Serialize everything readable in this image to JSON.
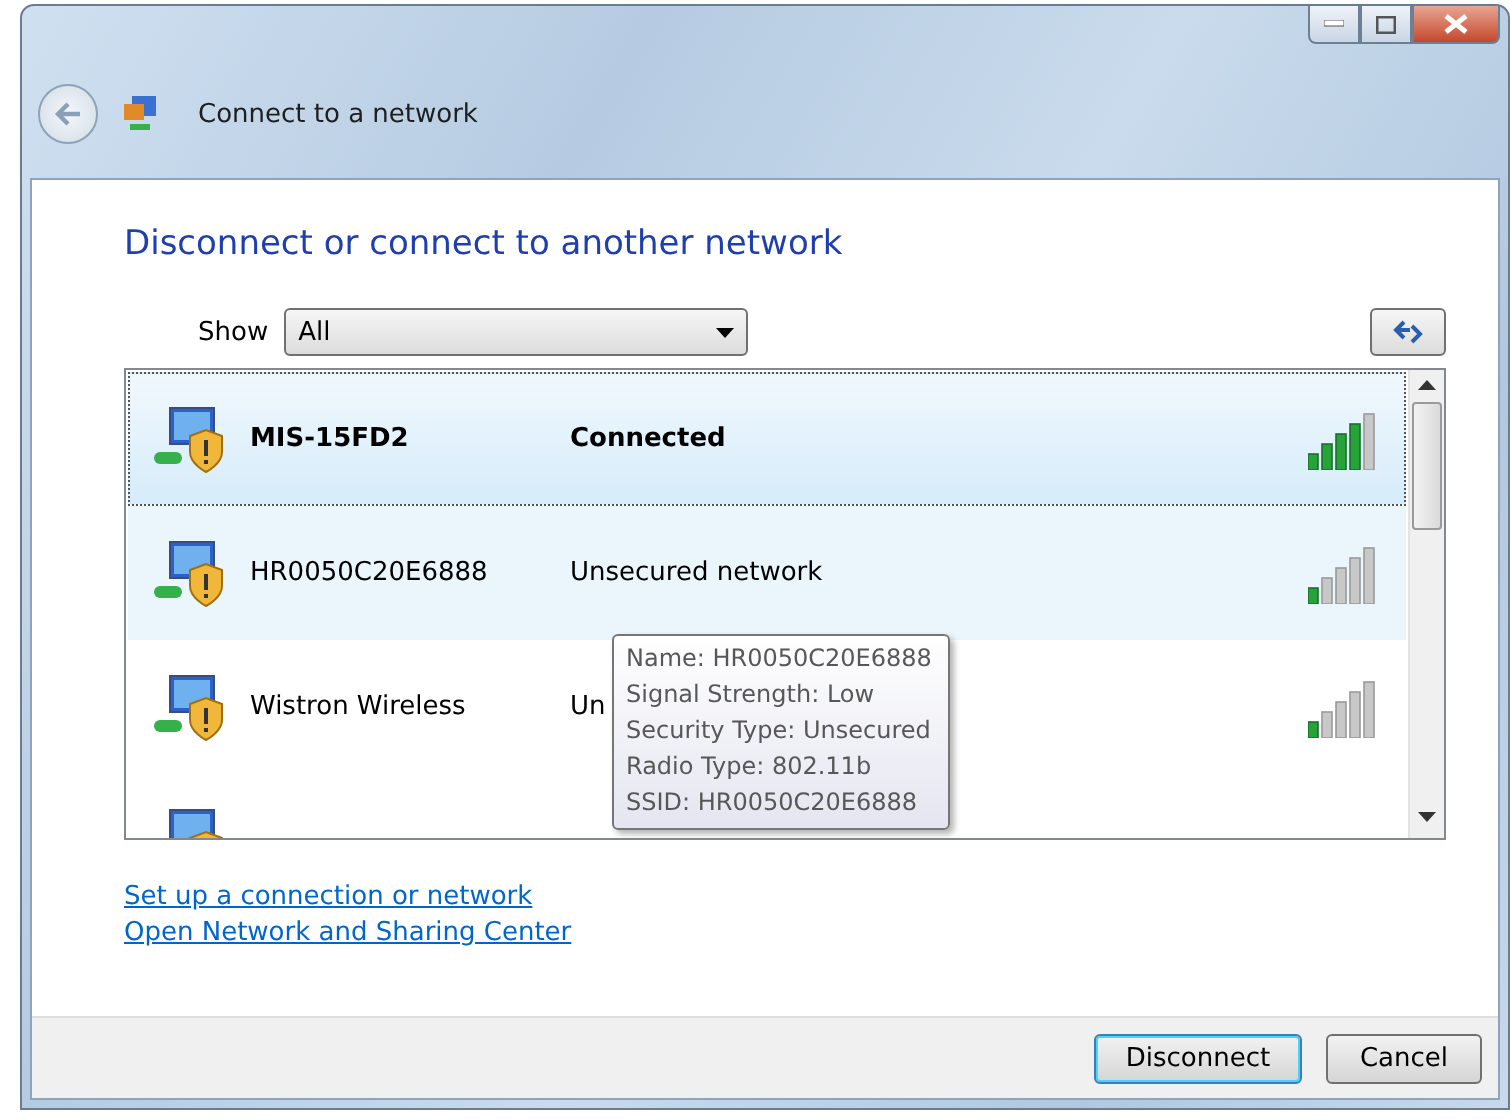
{
  "window": {
    "title": "Connect to a network"
  },
  "heading": "Disconnect or connect to another network",
  "filter": {
    "label": "Show",
    "value": "All"
  },
  "networks": [
    {
      "name": "MIS-15FD2",
      "status": "Connected",
      "connected": true,
      "selected": true,
      "hovered": false,
      "kind": "strong"
    },
    {
      "name": "HR0050C20E6888",
      "status": "Unsecured network",
      "connected": false,
      "selected": false,
      "hovered": true,
      "kind": "weak"
    },
    {
      "name": "Wistron Wireless",
      "status": "Un",
      "connected": false,
      "selected": false,
      "hovered": false,
      "kind": "weak"
    },
    {
      "selected": false,
      "hovered": false,
      "kind": "partial"
    }
  ],
  "tooltip": [
    "Name: HR0050C20E6888",
    "Signal Strength: Low",
    "Security Type: Unsecured",
    "Radio Type: 802.11b",
    "SSID: HR0050C20E6888"
  ],
  "links": [
    "Set up a connection or network",
    "Open Network and Sharing Center"
  ],
  "buttons": [
    {
      "label": "Disconnect",
      "default": true
    },
    {
      "label": "Cancel",
      "default": false
    }
  ]
}
